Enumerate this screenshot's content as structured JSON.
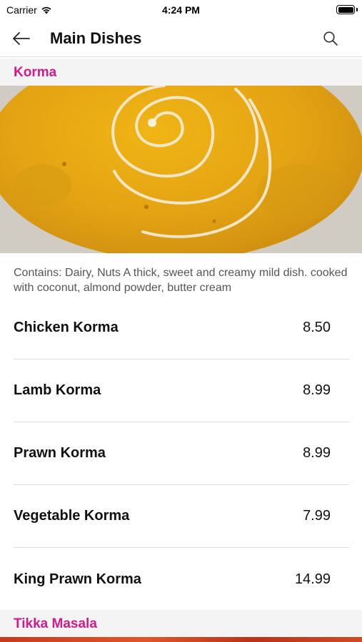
{
  "status_bar": {
    "carrier": "Carrier",
    "time": "4:24 PM",
    "wifi_icon": "wifi-icon",
    "battery_icon": "battery-icon"
  },
  "nav": {
    "title": "Main Dishes",
    "back_icon": "arrow-left-icon",
    "search_icon": "search-icon"
  },
  "sections": [
    {
      "title": "Korma",
      "description": "Contains: Dairy, Nuts A thick, sweet and creamy mild dish. cooked with coconut, almond powder, butter cream",
      "items": [
        {
          "name": "Chicken Korma",
          "price": "8.50"
        },
        {
          "name": "Lamb Korma",
          "price": "8.99"
        },
        {
          "name": "Prawn Korma",
          "price": "8.99"
        },
        {
          "name": "Vegetable Korma",
          "price": "7.99"
        },
        {
          "name": "King Prawn Korma",
          "price": "14.99"
        }
      ]
    },
    {
      "title": "Tikka Masala"
    }
  ],
  "colors": {
    "section_title": "#d6198a",
    "section_header_bg": "#f4f4f4",
    "divider": "#dcdcdc"
  }
}
